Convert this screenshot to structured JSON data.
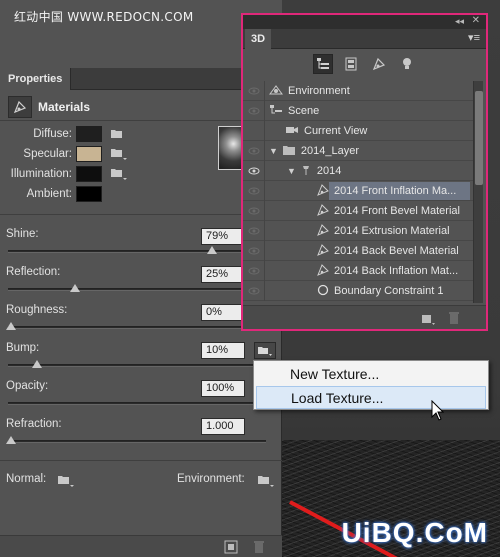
{
  "watermarks": {
    "top": "红动中国 WWW.REDOCN.COM",
    "bottom": "UiBQ.CoM"
  },
  "properties": {
    "tab_label": "Properties",
    "title": "Materials",
    "colors": [
      {
        "label": "Diffuse:",
        "hex": "#1f1f1f"
      },
      {
        "label": "Specular:",
        "hex": "#c8b493"
      },
      {
        "label": "Illumination:",
        "hex": "#0e0e0e"
      },
      {
        "label": "Ambient:",
        "hex": "#000000"
      }
    ],
    "sliders": {
      "shine": {
        "label": "Shine:",
        "value": "79%",
        "level": 0.79
      },
      "reflection": {
        "label": "Reflection:",
        "value": "25%",
        "level": 0.25
      },
      "roughness": {
        "label": "Roughness:",
        "value": "0%",
        "level": 0.0
      },
      "bump": {
        "label": "Bump:",
        "value": "10%",
        "level": 0.1
      },
      "opacity": {
        "label": "Opacity:",
        "value": "100%",
        "level": 1.0
      },
      "refraction": {
        "label": "Refraction:",
        "value": "1.000",
        "level": 0.0
      }
    },
    "normal_label": "Normal:",
    "environment_label": "Environment:"
  },
  "panel3d": {
    "tab_label": "3D",
    "tree": [
      {
        "label": "Environment",
        "icon": "environment-icon",
        "depth": 0
      },
      {
        "label": "Scene",
        "icon": "scene-icon",
        "depth": 0
      },
      {
        "label": "Current View",
        "icon": "camera-icon",
        "depth": 1
      },
      {
        "label": "2014_Layer",
        "icon": "folder-icon",
        "depth": 0
      },
      {
        "label": "2014",
        "icon": "mesh-icon",
        "depth": 1
      },
      {
        "label": "2014 Front Inflation Ma...",
        "icon": "material-icon",
        "depth": 2
      },
      {
        "label": "2014 Front Bevel Material",
        "icon": "material-icon",
        "depth": 2
      },
      {
        "label": "2014 Extrusion Material",
        "icon": "material-icon",
        "depth": 2
      },
      {
        "label": "2014 Back Bevel Material",
        "icon": "material-icon",
        "depth": 2
      },
      {
        "label": "2014 Back Inflation Mat...",
        "icon": "material-icon",
        "depth": 2
      },
      {
        "label": "Boundary Constraint 1",
        "icon": "constraint-icon",
        "depth": 2
      }
    ]
  },
  "context_menu": {
    "items": [
      "New Texture...",
      "Load Texture..."
    ]
  },
  "colors": {
    "highlight_border": "#e0287a",
    "accent_red": "#e01c1c"
  }
}
